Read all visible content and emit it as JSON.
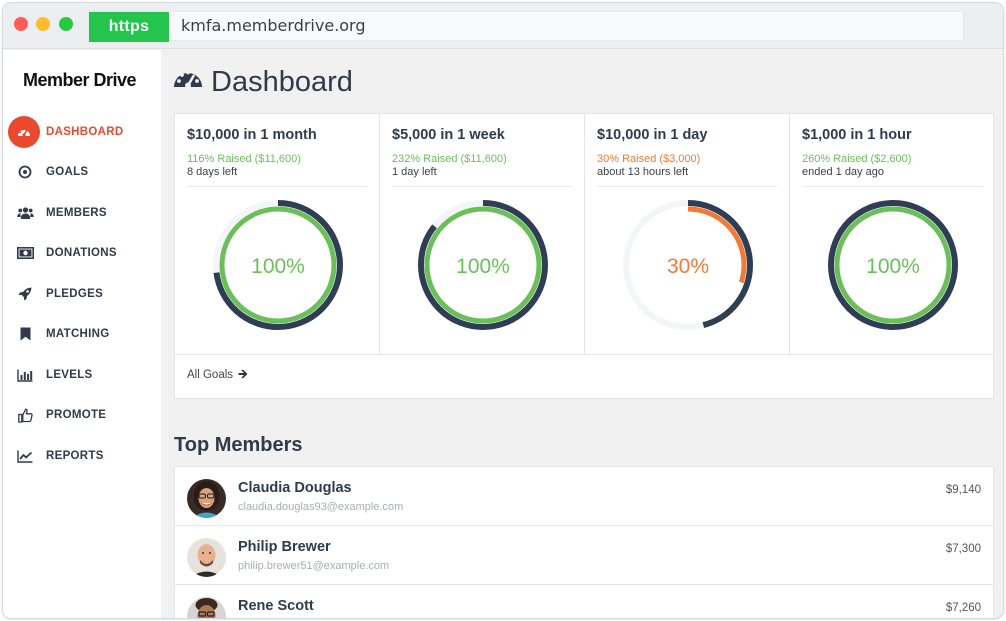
{
  "browser": {
    "protocol": "https",
    "url": "kmfa.memberdrive.org"
  },
  "sidebar": {
    "brand": "Member Drive",
    "items": [
      {
        "label": "DASHBOARD",
        "icon": "dashboard-gauge-icon",
        "active": true
      },
      {
        "label": "GOALS",
        "icon": "target-icon",
        "active": false
      },
      {
        "label": "MEMBERS",
        "icon": "users-icon",
        "active": false
      },
      {
        "label": "DONATIONS",
        "icon": "money-icon",
        "active": false
      },
      {
        "label": "PLEDGES",
        "icon": "rocket-icon",
        "active": false
      },
      {
        "label": "MATCHING",
        "icon": "bookmark-icon",
        "active": false
      },
      {
        "label": "LEVELS",
        "icon": "bar-chart-icon",
        "active": false
      },
      {
        "label": "PROMOTE",
        "icon": "thumbs-up-icon",
        "active": false
      },
      {
        "label": "REPORTS",
        "icon": "line-chart-icon",
        "active": false
      }
    ]
  },
  "page": {
    "title": "Dashboard",
    "icon": "dashboard-gauge-icon"
  },
  "goals": [
    {
      "title": "$10,000 in 1 month",
      "raised": "116% Raised ($11,600)",
      "time_left": "8 days left",
      "gauge_label": "100%",
      "progress": 1.0,
      "elapsed": 0.73,
      "status_color": "#6bbf59"
    },
    {
      "title": "$5,000 in 1 week",
      "raised": "232% Raised ($11,600)",
      "time_left": "1 day left",
      "gauge_label": "100%",
      "progress": 1.0,
      "elapsed": 0.857,
      "status_color": "#6bbf59"
    },
    {
      "title": "$10,000 in 1 day",
      "raised": "30% Raised ($3,000)",
      "time_left": "about 13 hours left",
      "gauge_label": "30%",
      "progress": 0.3,
      "elapsed": 0.46,
      "status_color": "#f07a36"
    },
    {
      "title": "$1,000 in 1 hour",
      "raised": "260% Raised ($2,600)",
      "time_left": "ended 1 day ago",
      "gauge_label": "100%",
      "progress": 1.0,
      "elapsed": 1.0,
      "status_color": "#6bbf59"
    }
  ],
  "goals_footer": {
    "link": "All Goals"
  },
  "top_members": {
    "title": "Top Members",
    "rows": [
      {
        "name": "Claudia Douglas",
        "email": "claudia.douglas93@example.com",
        "amount": "$9,140"
      },
      {
        "name": "Philip Brewer",
        "email": "philip.brewer51@example.com",
        "amount": "$7,300"
      },
      {
        "name": "Rene Scott",
        "email": "",
        "amount": "$7,260"
      }
    ]
  },
  "colors": {
    "accent": "#e8492f",
    "progress_green": "#6bbf59",
    "progress_orange": "#f07a36",
    "elapsed_navy": "#2f3e55",
    "track": "#f4f5f6"
  }
}
